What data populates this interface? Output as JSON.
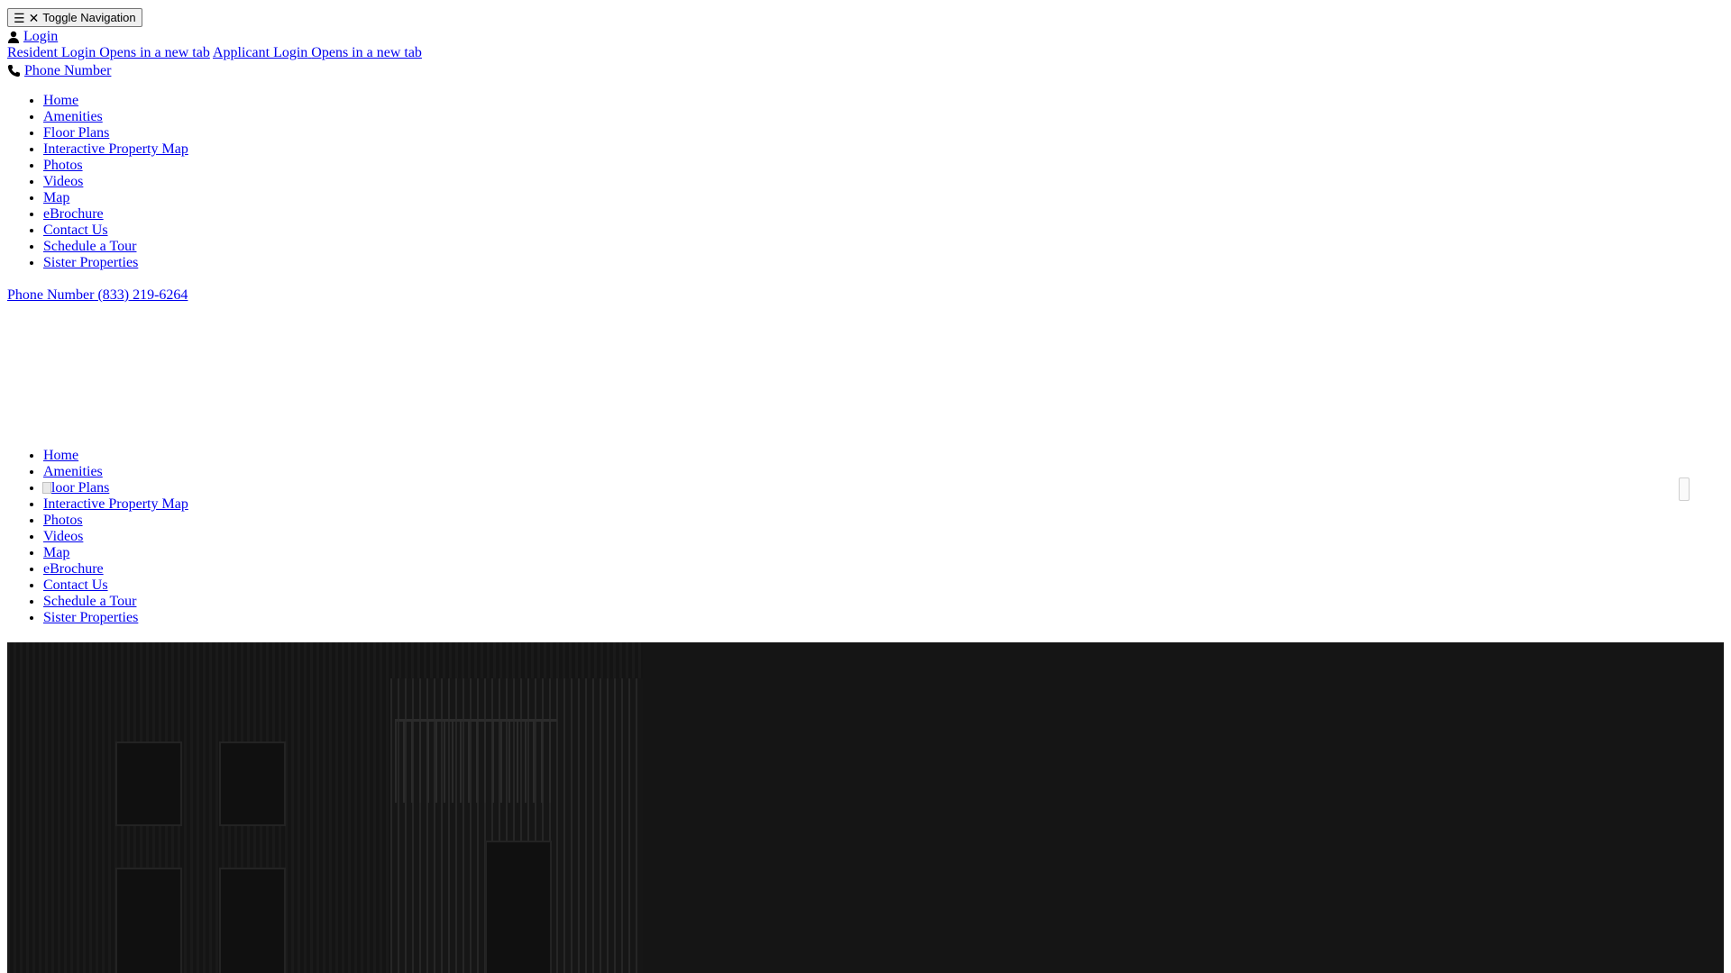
{
  "header": {
    "toggle_label": "Toggle Navigation",
    "toggle_hamburger_glyph": "☰",
    "toggle_close_glyph": "✕",
    "login_label": "Login",
    "resident_login": "Resident Login",
    "resident_login_note": "Opens in a new tab",
    "applicant_login": "Applicant Login",
    "applicant_login_note": "Opens in a new tab",
    "phone_label": "Phone Number"
  },
  "nav_top": {
    "items": [
      {
        "label": "Home"
      },
      {
        "label": "Amenities"
      },
      {
        "label": "Floor Plans"
      },
      {
        "label": "Interactive Property Map"
      },
      {
        "label": "Photos"
      },
      {
        "label": "Videos"
      },
      {
        "label": "Map"
      },
      {
        "label": "eBrochure"
      },
      {
        "label": "Contact Us"
      },
      {
        "label": "Schedule a Tour"
      },
      {
        "label": "Sister Properties"
      }
    ]
  },
  "phone_block": {
    "label": "Phone Number",
    "number": "(833) 219-6264"
  },
  "nav_second": {
    "items": [
      {
        "label": "Home"
      },
      {
        "label": "Amenities"
      },
      {
        "label": "Floor Plans"
      },
      {
        "label": "Interactive Property Map"
      },
      {
        "label": "Photos"
      },
      {
        "label": "Videos"
      },
      {
        "label": "Map"
      },
      {
        "label": "eBrochure"
      },
      {
        "label": "Contact Us"
      },
      {
        "label": "Schedule a Tour"
      },
      {
        "label": "Sister Properties"
      }
    ]
  },
  "colors": {
    "link": "#0000ee",
    "hero_background": "#151515"
  }
}
